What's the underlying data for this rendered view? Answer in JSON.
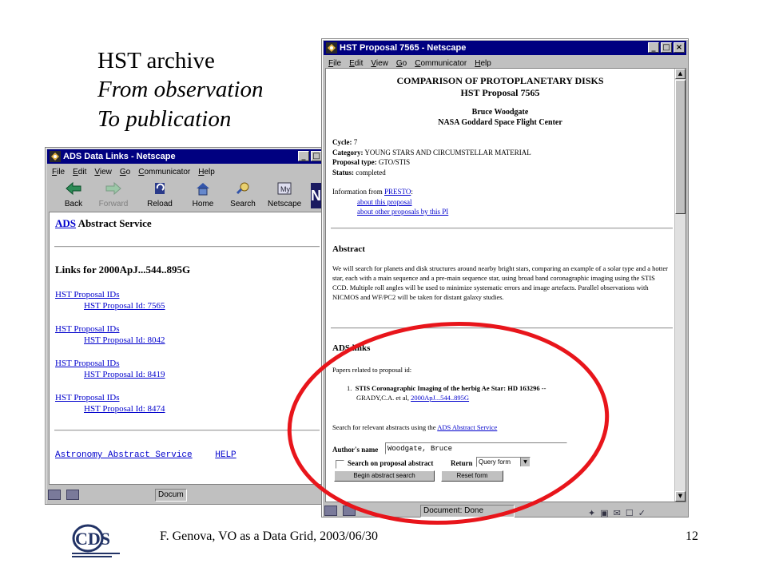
{
  "slide": {
    "title_lines": [
      "HST archive",
      "From observation",
      "To publication"
    ],
    "footer_text": "F. Genova, VO as a Data Grid, 2003/06/30",
    "page_number": "12",
    "logo_text": "CDS",
    "highlight_color": "#e8151b"
  },
  "ads_window": {
    "title": "ADS Data Links - Netscape",
    "menu": [
      "File",
      "Edit",
      "View",
      "Go",
      "Communicator",
      "Help"
    ],
    "toolbar": [
      {
        "label": "Back",
        "icon": "back-arrow-icon",
        "enabled": true
      },
      {
        "label": "Forward",
        "icon": "forward-arrow-icon",
        "enabled": false
      },
      {
        "label": "Reload",
        "icon": "reload-icon",
        "enabled": true
      },
      {
        "label": "Home",
        "icon": "home-icon",
        "enabled": true
      },
      {
        "label": "Search",
        "icon": "search-icon",
        "enabled": true
      },
      {
        "label": "Netscape",
        "icon": "netscape-icon",
        "enabled": true
      }
    ],
    "header_link": "ADS",
    "header_text": "Abstract Service",
    "links_heading": "Links for 2000ApJ...544..895G",
    "groups": [
      {
        "group_label": "HST Proposal IDs",
        "item": "HST Proposal Id: 7565"
      },
      {
        "group_label": "HST Proposal IDs",
        "item": "HST Proposal Id: 8042"
      },
      {
        "group_label": "HST Proposal IDs",
        "item": "HST Proposal Id: 8419"
      },
      {
        "group_label": "HST Proposal IDs",
        "item": "HST Proposal Id: 8474"
      }
    ],
    "footer_links": [
      "Astronomy Abstract Service",
      "HELP"
    ],
    "status_text": "Docum"
  },
  "hst_window": {
    "title": "HST Proposal 7565 - Netscape",
    "menu": [
      "File",
      "Edit",
      "View",
      "Go",
      "Communicator",
      "Help"
    ],
    "heading1": "COMPARISON OF PROTOPLANETARY DISKS",
    "heading2": "HST Proposal 7565",
    "author": "Bruce Woodgate",
    "institution": "NASA Goddard Space Flight Center",
    "fields": [
      {
        "label": "Cycle:",
        "value": "7"
      },
      {
        "label": "Category:",
        "value": "YOUNG STARS AND CIRCUMSTELLAR MATERIAL"
      },
      {
        "label": "Proposal type:",
        "value": "GTO/STIS"
      },
      {
        "label": "Status:",
        "value": "completed"
      }
    ],
    "info_prefix": "Information from",
    "info_link": "PRESTO",
    "info_suffix": ":",
    "info_links": [
      "about this proposal",
      "about other proposals by this PI"
    ],
    "abstract_heading": "Abstract",
    "abstract_text": "We will search for planets and disk structures around nearby bright stars, comparing an example of a solar type and a hotter star, each with a main sequence and a pre-main sequence star, using broad band coronagraphic imaging using the STIS CCD. Multiple roll angles will be used to minimize systematic errors and image artefacts. Parallel observations with NICMOS and WF/PC2 will be taken for distant galaxy studies.",
    "ads_heading": "ADS links",
    "papers_label": "Papers related to proposal id:",
    "paper_number": "1.",
    "paper_title": "STIS Coronagraphic Imaging of the herbig Ae Star: HD 163296",
    "paper_dash": "--",
    "paper_authors": "GRADY,C.A. et al,",
    "paper_bibcode": "2000ApJ...544..895G",
    "search_prefix": "Search for relevant abstracts using the",
    "search_link": "ADS Abstract Service",
    "author_label": "Author's name",
    "author_value": "Woodgate, Bruce",
    "checkbox_label": "Search on proposal abstract",
    "return_label": "Return",
    "return_selected": "Query form",
    "begin_button": "Begin abstract search",
    "reset_button": "Reset form",
    "status_text": "Document: Done"
  }
}
